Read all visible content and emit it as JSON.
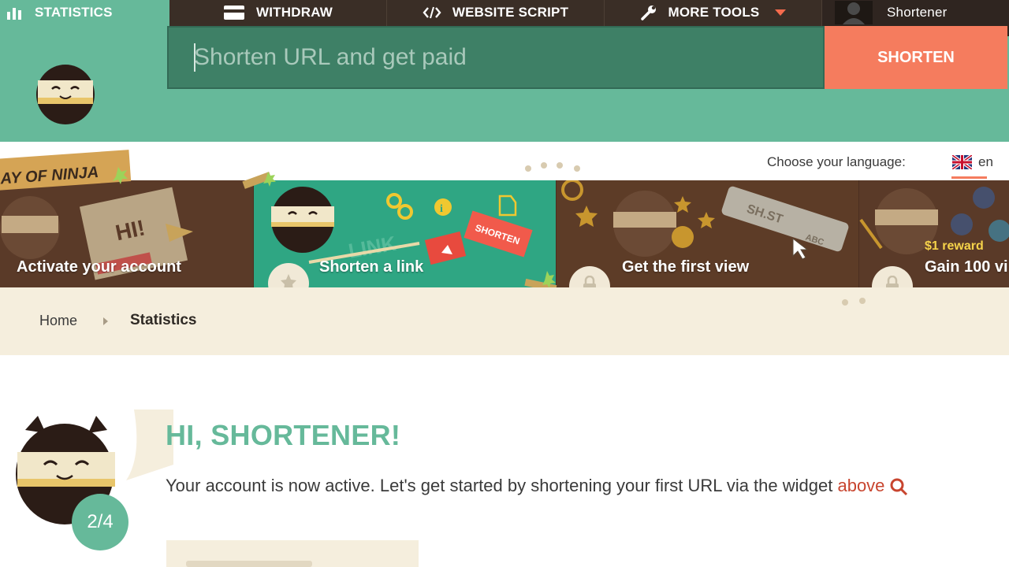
{
  "nav": {
    "statistics": "STATISTICS",
    "withdraw": "WITHDRAW",
    "website_script": "WEBSITE SCRIPT",
    "more_tools": "MORE TOOLS",
    "user": "Shortener"
  },
  "shorten": {
    "placeholder": "Shorten URL and get paid",
    "button": "SHORTEN"
  },
  "language": {
    "label": "Choose your language:",
    "code": "en"
  },
  "steps": [
    {
      "title": "Activate your account"
    },
    {
      "title": "Shorten a link"
    },
    {
      "title": "Get the first view"
    },
    {
      "title": "Gain 100 vi",
      "reward": "$1 reward"
    }
  ],
  "banner": {
    "way_of_ninja": "AY OF NINJA",
    "hi": "HI!",
    "link": "LINK",
    "shorten_tag": "SHORTEN",
    "shst": "SH.ST",
    "abc": "ABC"
  },
  "breadcrumb": {
    "home": "Home",
    "current": "Statistics"
  },
  "welcome": {
    "title": "HI, SHORTENER!",
    "text": "Your account is now active. Let's get started by shortening your first URL via the widget ",
    "link": "above",
    "step": "2/4"
  },
  "colors": {
    "green": "#66b99a",
    "dark_brown": "#3a2e26",
    "orange": "#f57c5e",
    "cream": "#f5eedd"
  }
}
